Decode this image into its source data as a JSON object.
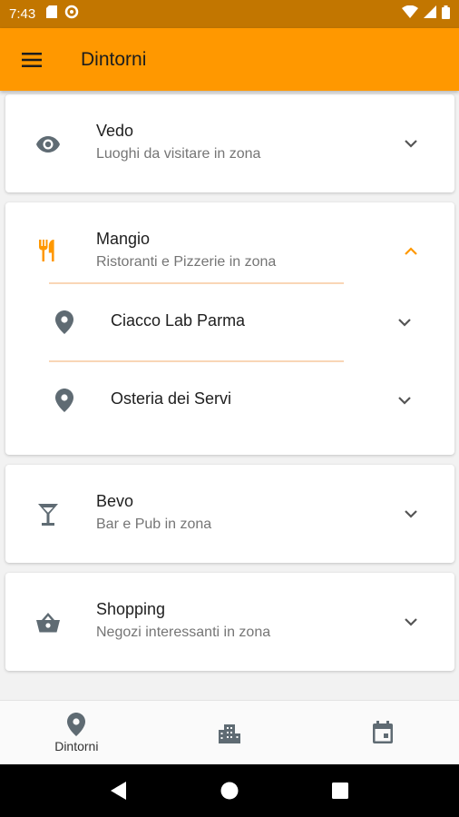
{
  "status": {
    "time": "7:43"
  },
  "appbar": {
    "title": "Dintorni"
  },
  "colors": {
    "accent": "#ff9800",
    "status_bar": "#c27600",
    "icon_grey": "#5f6b73"
  },
  "sections": [
    {
      "title": "Vedo",
      "subtitle": "Luoghi da visitare in zona",
      "icon": "eye-icon",
      "expanded": false
    },
    {
      "title": "Mangio",
      "subtitle": "Ristoranti e Pizzerie in zona",
      "icon": "restaurant-icon",
      "expanded": true,
      "items": [
        {
          "label": "Ciacco Lab Parma"
        },
        {
          "label": "Osteria dei Servi"
        }
      ]
    },
    {
      "title": "Bevo",
      "subtitle": "Bar e Pub in zona",
      "icon": "cocktail-icon",
      "expanded": false
    },
    {
      "title": "Shopping",
      "subtitle": "Negozi interessanti in zona",
      "icon": "basket-icon",
      "expanded": false
    }
  ],
  "bottom_nav": [
    {
      "label": "Dintorni",
      "icon": "location-pin-icon",
      "active": true
    },
    {
      "label": "",
      "icon": "city-icon",
      "active": false
    },
    {
      "label": "",
      "icon": "calendar-icon",
      "active": false
    }
  ]
}
